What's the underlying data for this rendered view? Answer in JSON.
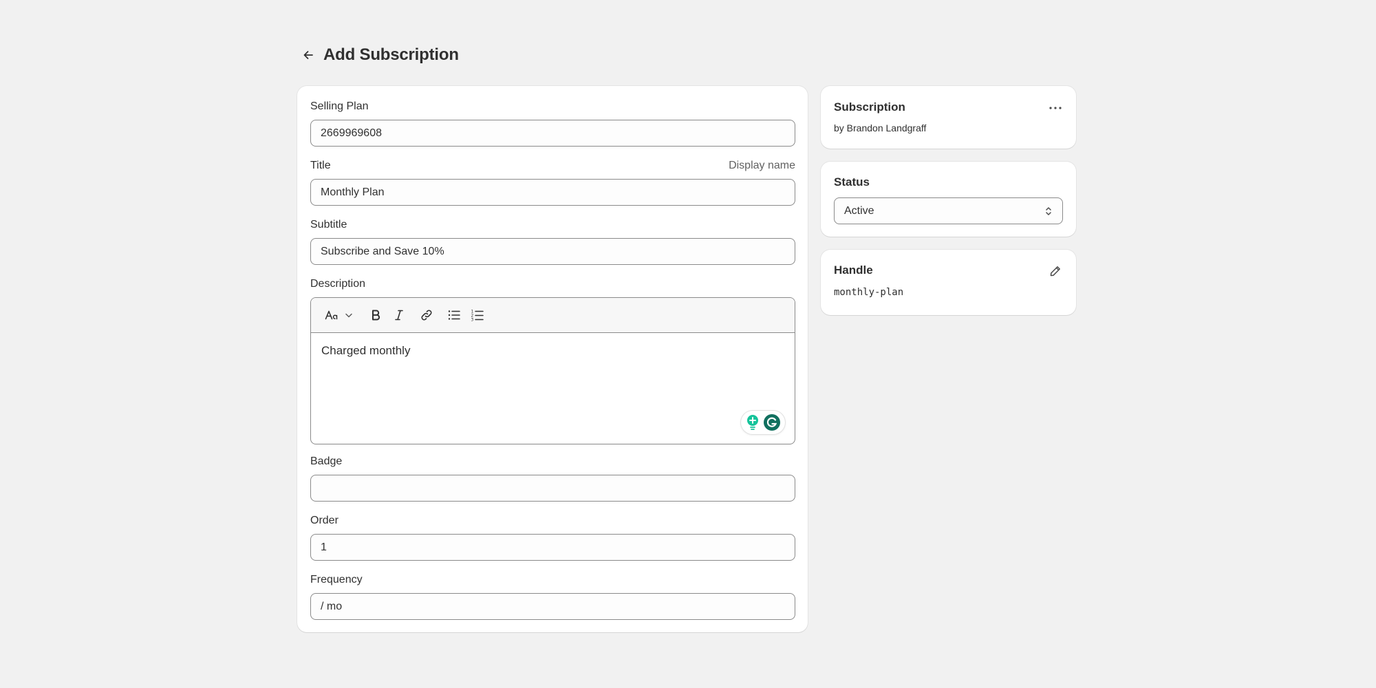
{
  "header": {
    "title": "Add Subscription"
  },
  "form": {
    "selling_plan": {
      "label": "Selling Plan",
      "value": "2669969608"
    },
    "title": {
      "label": "Title",
      "hint": "Display name",
      "value": "Monthly Plan"
    },
    "subtitle": {
      "label": "Subtitle",
      "value": "Subscribe and Save 10%"
    },
    "description": {
      "label": "Description",
      "content": "Charged monthly",
      "toolbar": [
        "text-format",
        "bold",
        "italic",
        "link",
        "bullet-list",
        "numbered-list"
      ]
    },
    "badge": {
      "label": "Badge",
      "value": ""
    },
    "order": {
      "label": "Order",
      "value": "1"
    },
    "frequency": {
      "label": "Frequency",
      "value": "/ mo"
    }
  },
  "sidebar": {
    "app_card": {
      "title": "Subscription",
      "byline": "by Brandon Landgraff"
    },
    "status_card": {
      "title": "Status",
      "selected": "Active"
    },
    "handle_card": {
      "title": "Handle",
      "value": "monthly-plan"
    }
  },
  "colors": {
    "background": "#f1f1f1",
    "card": "#ffffff",
    "border": "#8a8a8a",
    "text": "#303030",
    "muted": "#616161",
    "grammarly_green": "#15c39a",
    "grammarly_dark": "#11705f"
  }
}
